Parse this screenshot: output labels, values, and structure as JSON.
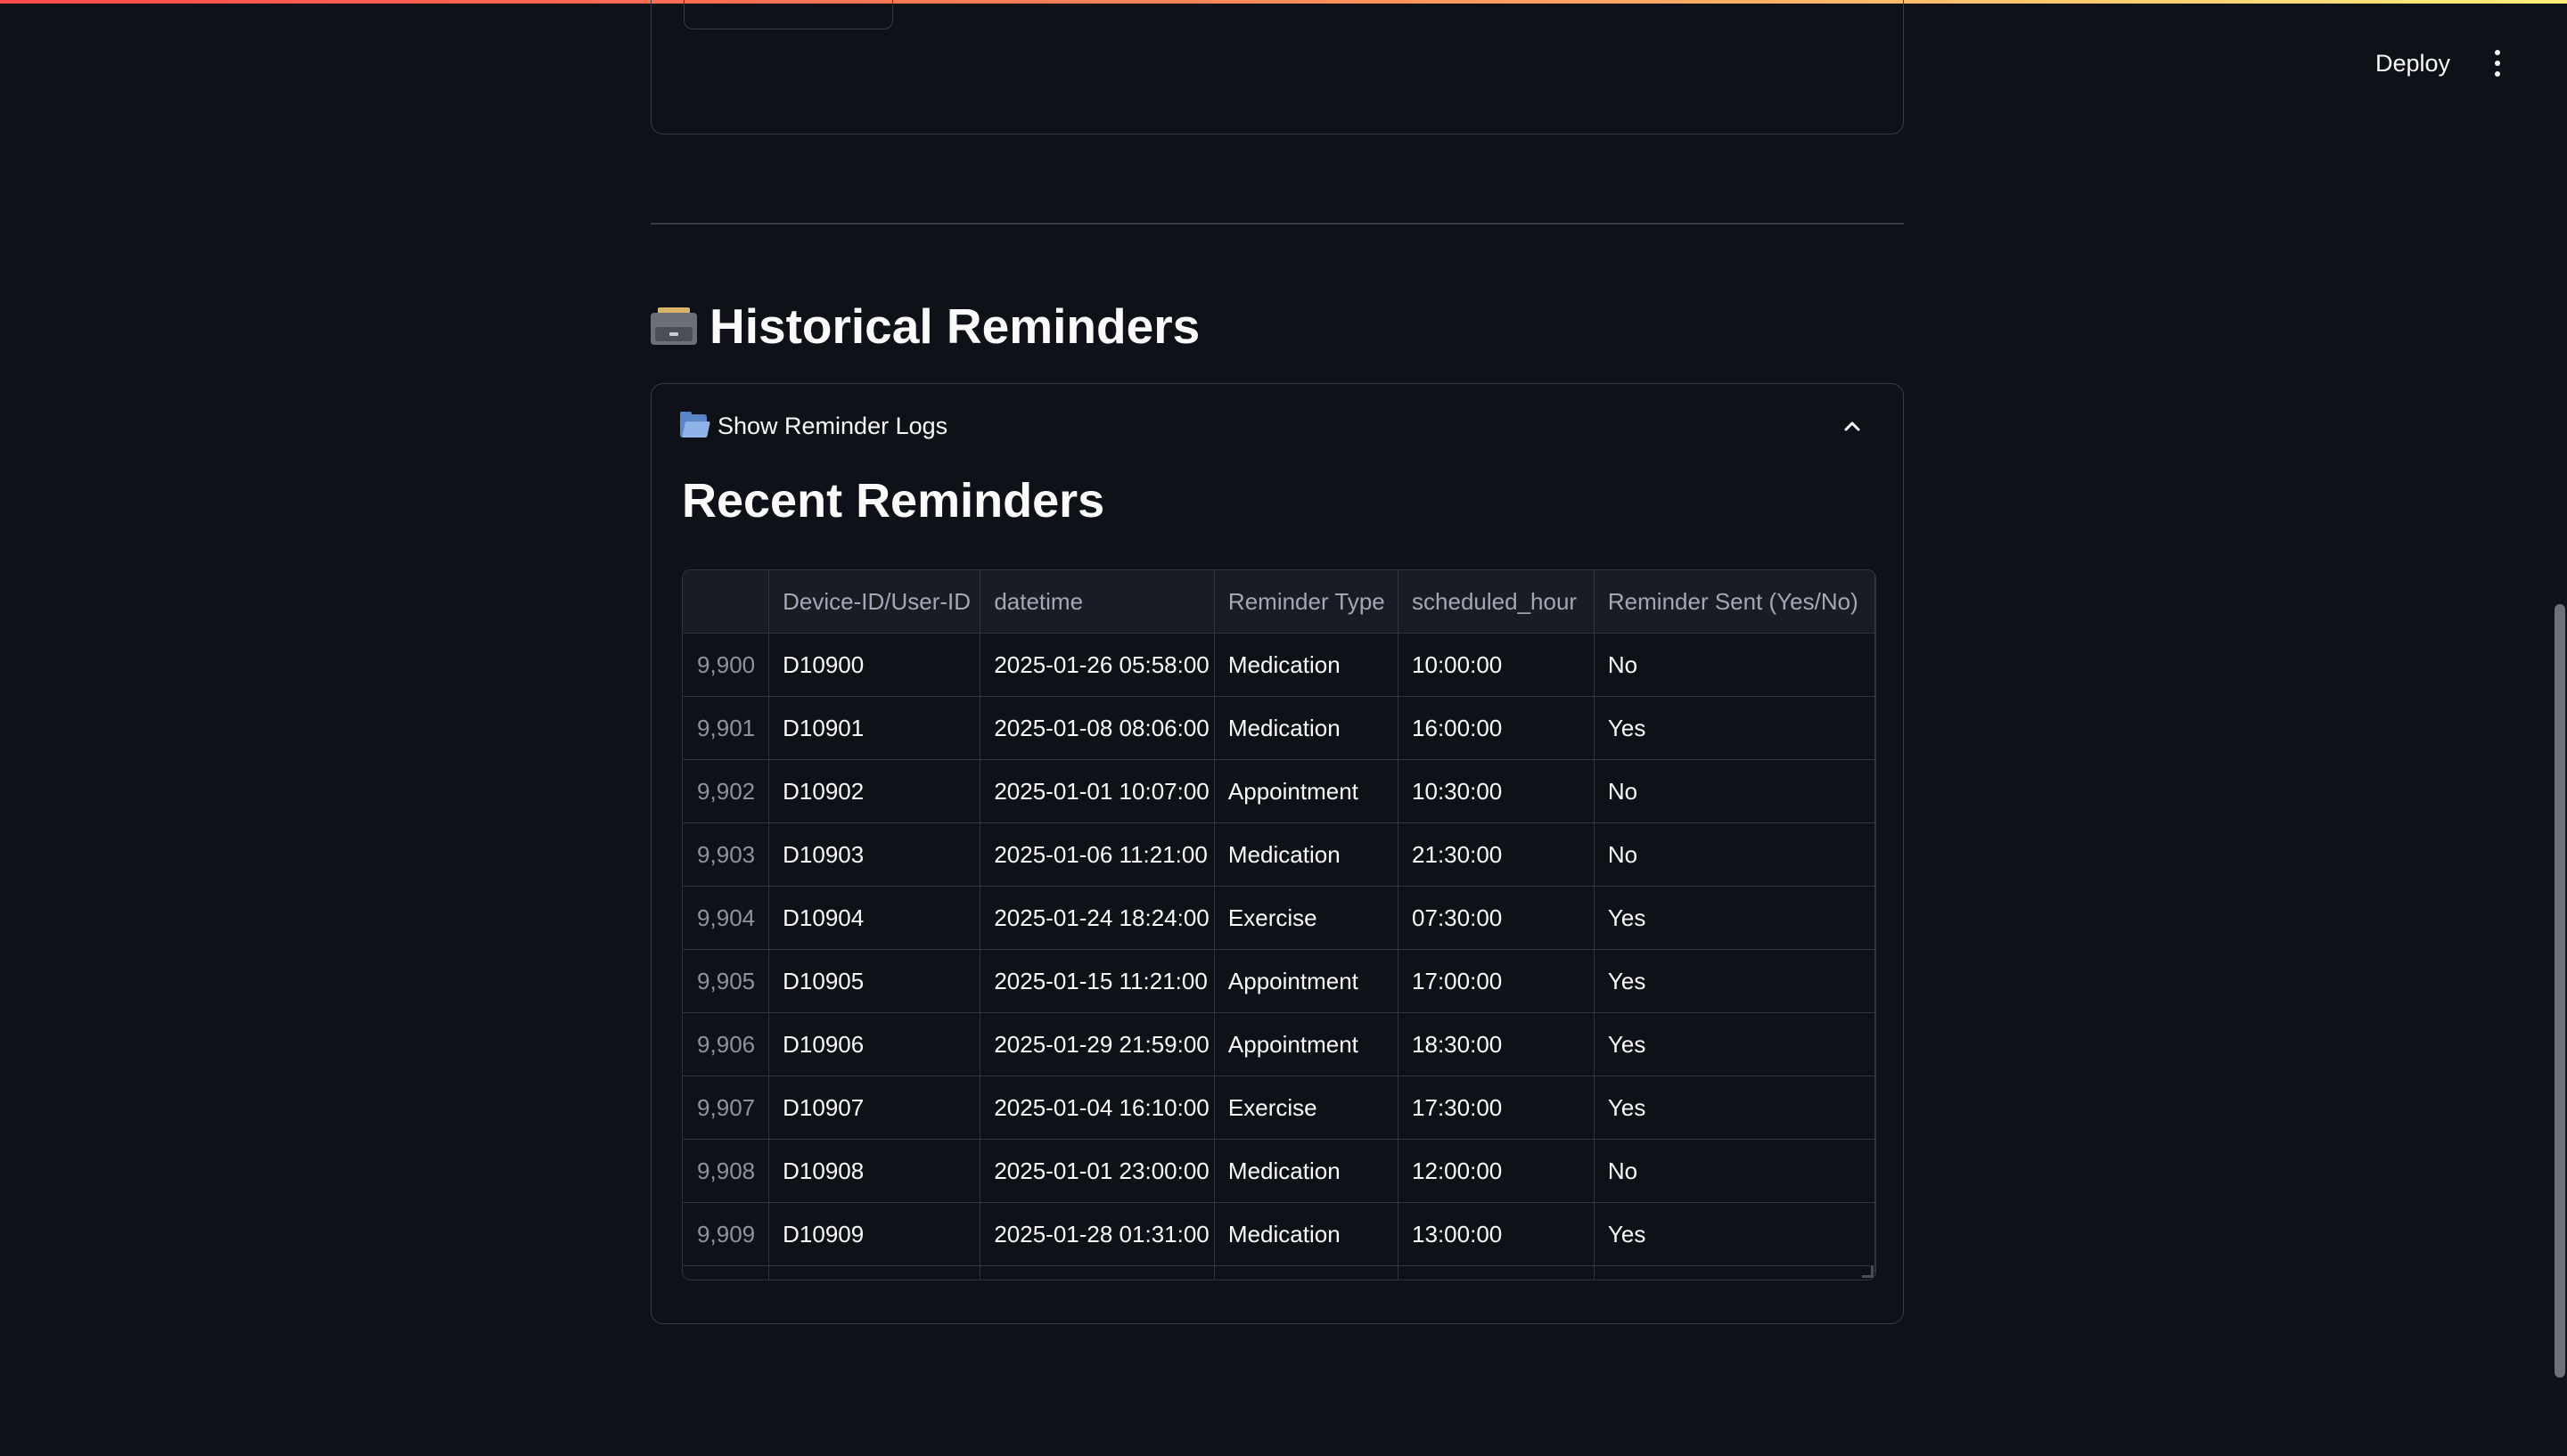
{
  "header": {
    "deploy_label": "Deploy"
  },
  "section": {
    "title": "Historical Reminders"
  },
  "expander": {
    "label": "Show Reminder Logs"
  },
  "table_title": "Recent Reminders",
  "table": {
    "columns": [
      "",
      "Device-ID/User-ID",
      "datetime",
      "Reminder Type",
      "scheduled_hour",
      "Reminder Sent (Yes/No)"
    ],
    "rows": [
      [
        "9,900",
        "D10900",
        "2025-01-26 05:58:00",
        "Medication",
        "10:00:00",
        "No"
      ],
      [
        "9,901",
        "D10901",
        "2025-01-08 08:06:00",
        "Medication",
        "16:00:00",
        "Yes"
      ],
      [
        "9,902",
        "D10902",
        "2025-01-01 10:07:00",
        "Appointment",
        "10:30:00",
        "No"
      ],
      [
        "9,903",
        "D10903",
        "2025-01-06 11:21:00",
        "Medication",
        "21:30:00",
        "No"
      ],
      [
        "9,904",
        "D10904",
        "2025-01-24 18:24:00",
        "Exercise",
        "07:30:00",
        "Yes"
      ],
      [
        "9,905",
        "D10905",
        "2025-01-15 11:21:00",
        "Appointment",
        "17:00:00",
        "Yes"
      ],
      [
        "9,906",
        "D10906",
        "2025-01-29 21:59:00",
        "Appointment",
        "18:30:00",
        "Yes"
      ],
      [
        "9,907",
        "D10907",
        "2025-01-04 16:10:00",
        "Exercise",
        "17:30:00",
        "Yes"
      ],
      [
        "9,908",
        "D10908",
        "2025-01-01 23:00:00",
        "Medication",
        "12:00:00",
        "No"
      ],
      [
        "9,909",
        "D10909",
        "2025-01-28 01:31:00",
        "Medication",
        "13:00:00",
        "Yes"
      ]
    ]
  }
}
